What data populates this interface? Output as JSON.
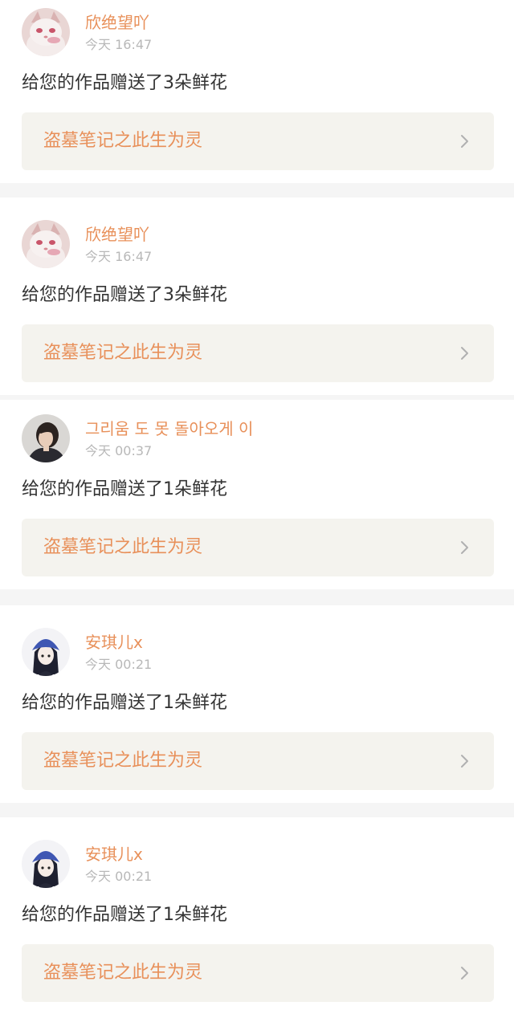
{
  "notifications": [
    {
      "username": "欣绝望吖",
      "time": "今天 16:47",
      "message": "给您的作品赠送了3朵鲜花",
      "work_title": "盗墓笔记之此生为灵",
      "avatar_icon": "cat-avatar-icon"
    },
    {
      "username": "欣绝望吖",
      "time": "今天 16:47",
      "message": "给您的作品赠送了3朵鲜花",
      "work_title": "盗墓笔记之此生为灵",
      "avatar_icon": "cat-avatar-icon"
    },
    {
      "username": "그리움 도 못 돌아오게 이",
      "time": "今天 00:37",
      "message": "给您的作品赠送了1朵鲜花",
      "work_title": "盗墓笔记之此生为灵",
      "avatar_icon": "girl-photo-avatar-icon"
    },
    {
      "username": "安琪儿x",
      "time": "今天 00:21",
      "message": "给您的作品赠送了1朵鲜花",
      "work_title": "盗墓笔记之此生为灵",
      "avatar_icon": "anime-girl-avatar-icon"
    },
    {
      "username": "安琪儿x",
      "time": "今天 00:21",
      "message": "给您的作品赠送了1朵鲜花",
      "work_title": "盗墓笔记之此生为灵",
      "avatar_icon": "anime-girl-avatar-icon"
    }
  ],
  "colors": {
    "accent": "#e8905a",
    "time": "#b8b8b8",
    "text": "#333333",
    "link_bg": "#f4f3ee",
    "separator": "#f5f5f5"
  }
}
